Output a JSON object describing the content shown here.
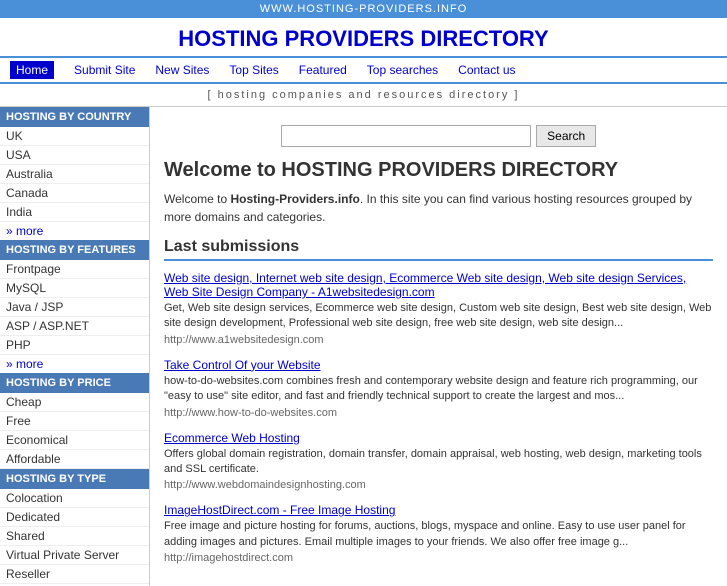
{
  "topbar": {
    "url": "WWW.HOSTING-PROVIDERS.INFO"
  },
  "header": {
    "title": "HOSTING PROVIDERS DIRECTORY"
  },
  "nav": {
    "items": [
      {
        "label": "Home",
        "active": true
      },
      {
        "label": "Submit Site",
        "active": false
      },
      {
        "label": "New Sites",
        "active": false
      },
      {
        "label": "Top Sites",
        "active": false
      },
      {
        "label": "Featured",
        "active": false
      },
      {
        "label": "Top searches",
        "active": false
      },
      {
        "label": "Contact us",
        "active": false
      }
    ]
  },
  "tagline": "[ hosting companies and resources directory ]",
  "sidebar": {
    "sections": [
      {
        "category": "HOSTING BY COUNTRY",
        "items": [
          "UK",
          "USA",
          "Australia",
          "Canada",
          "India"
        ],
        "more": "» more"
      },
      {
        "category": "HOSTING BY FEATURES",
        "items": [
          "Frontpage",
          "MySQL",
          "Java / JSP",
          "ASP / ASP.NET",
          "PHP"
        ],
        "more": "» more"
      },
      {
        "category": "HOSTING BY PRICE",
        "items": [
          "Cheap",
          "Free",
          "Economical",
          "Affordable"
        ],
        "more": null
      },
      {
        "category": "HOSTING BY TYPE",
        "items": [
          "Colocation",
          "Dedicated",
          "Shared",
          "Virtual Private Server",
          "Reseller"
        ],
        "more": null
      }
    ]
  },
  "search": {
    "placeholder": "",
    "button_label": "Search"
  },
  "welcome": {
    "title": "Welcome to HOSTING PROVIDERS DIRECTORY",
    "text_before": "Welcome to ",
    "text_brand": "Hosting-Providers.info",
    "text_after": ". In this site you can find various hosting resources grouped by more domains and categories."
  },
  "last_submissions": {
    "title": "Last submissions",
    "items": [
      {
        "title": "Web site design, Internet web site design, Ecommerce Web site design, Web site design Services, Web Site Design Company - A1websitedesign.com",
        "desc": "Get, Web site design services, Ecommerce web site design, Custom web site design, Best web site design, Web site design development, Professional web site design, free web site design, web site design...",
        "url": "http://www.a1websitedesign.com"
      },
      {
        "title": "Take Control Of your Website",
        "desc": "how-to-do-websites.com combines fresh and contemporary website design and feature rich programming, our \"easy to use\" site editor, and fast and friendly technical support to create the largest and mos...",
        "url": "http://www.how-to-do-websites.com"
      },
      {
        "title": "Ecommerce Web Hosting",
        "desc": "Offers global domain registration, domain transfer, domain appraisal, web hosting, web design, marketing tools and SSL certificate.",
        "url": "http://www.webdomaindesignhosting.com"
      },
      {
        "title": "ImageHostDirect.com - Free Image Hosting",
        "desc": "Free image and picture hosting for forums, auctions, blogs, myspace and online. Easy to use user panel for adding images and pictures. Email multiple images to your friends. We also offer free image g...",
        "url": "http://imagehostdirect.com"
      }
    ]
  }
}
